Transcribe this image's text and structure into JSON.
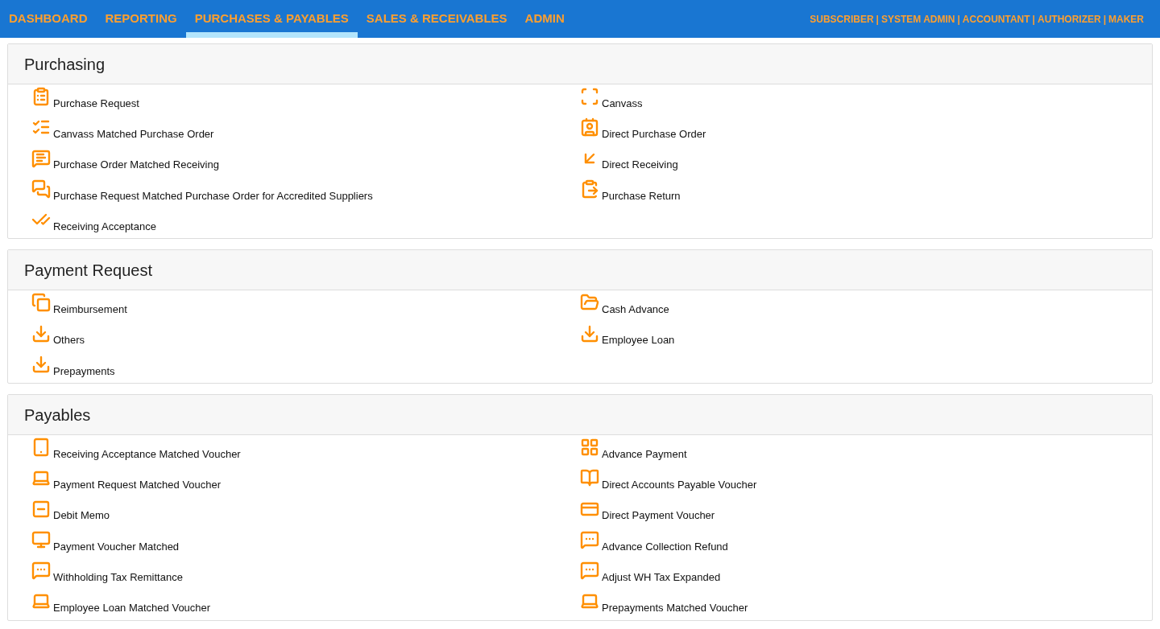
{
  "nav": {
    "tabs": [
      {
        "label": "DASHBOARD",
        "selected": false
      },
      {
        "label": "REPORTING",
        "selected": false
      },
      {
        "label": "PURCHASES & PAYABLES",
        "selected": true
      },
      {
        "label": "SALES & RECEIVABLES",
        "selected": false
      },
      {
        "label": "ADMIN",
        "selected": false
      }
    ],
    "roles": [
      "SUBSCRIBER",
      "SYSTEM ADMIN",
      "ACCOUNTANT",
      "AUTHORIZER",
      "MAKER"
    ],
    "separator": "|"
  },
  "sections": [
    {
      "title": "Purchasing",
      "items": [
        {
          "label": "Purchase Request",
          "kind": "clipboard"
        },
        {
          "label": "Canvass",
          "kind": "frame"
        },
        {
          "label": "Canvass Matched Purchase Order",
          "kind": "checklist"
        },
        {
          "label": "Direct Purchase Order",
          "kind": "contact"
        },
        {
          "label": "Purchase Order Matched Receiving",
          "kind": "chat"
        },
        {
          "label": "Direct Receiving",
          "kind": "arrow"
        },
        {
          "label": "Purchase Request Matched Purchase Order for Accredited Suppliers",
          "kind": "chats"
        },
        {
          "label": "Purchase Return",
          "kind": "return"
        },
        {
          "label": "Receiving Acceptance",
          "kind": "ticks"
        }
      ]
    },
    {
      "title": "Payment Request",
      "items": [
        {
          "label": "Reimbursement",
          "kind": "copy"
        },
        {
          "label": "Cash Advance",
          "kind": "folder"
        },
        {
          "label": "Others",
          "kind": "download"
        },
        {
          "label": "Employee Loan",
          "kind": "download"
        },
        {
          "label": "Prepayments",
          "kind": "download"
        }
      ]
    },
    {
      "title": "Payables",
      "items": [
        {
          "label": "Receiving Acceptance Matched Voucher",
          "kind": "tablet"
        },
        {
          "label": "Advance Payment",
          "kind": "grid"
        },
        {
          "label": "Payment Request Matched Voucher",
          "kind": "laptop"
        },
        {
          "label": "Direct Accounts Payable Voucher",
          "kind": "book"
        },
        {
          "label": "Debit Memo",
          "kind": "minus"
        },
        {
          "label": "Direct Payment Voucher",
          "kind": "card"
        },
        {
          "label": "Payment Voucher Matched",
          "kind": "monitor"
        },
        {
          "label": "Advance Collection Refund",
          "kind": "note"
        },
        {
          "label": "Withholding Tax Remittance",
          "kind": "note"
        },
        {
          "label": "Adjust WH Tax Expanded",
          "kind": "note"
        },
        {
          "label": "Employee Loan Matched Voucher",
          "kind": "laptop"
        },
        {
          "label": "Prepayments Matched Voucher",
          "kind": "laptop"
        }
      ]
    }
  ]
}
